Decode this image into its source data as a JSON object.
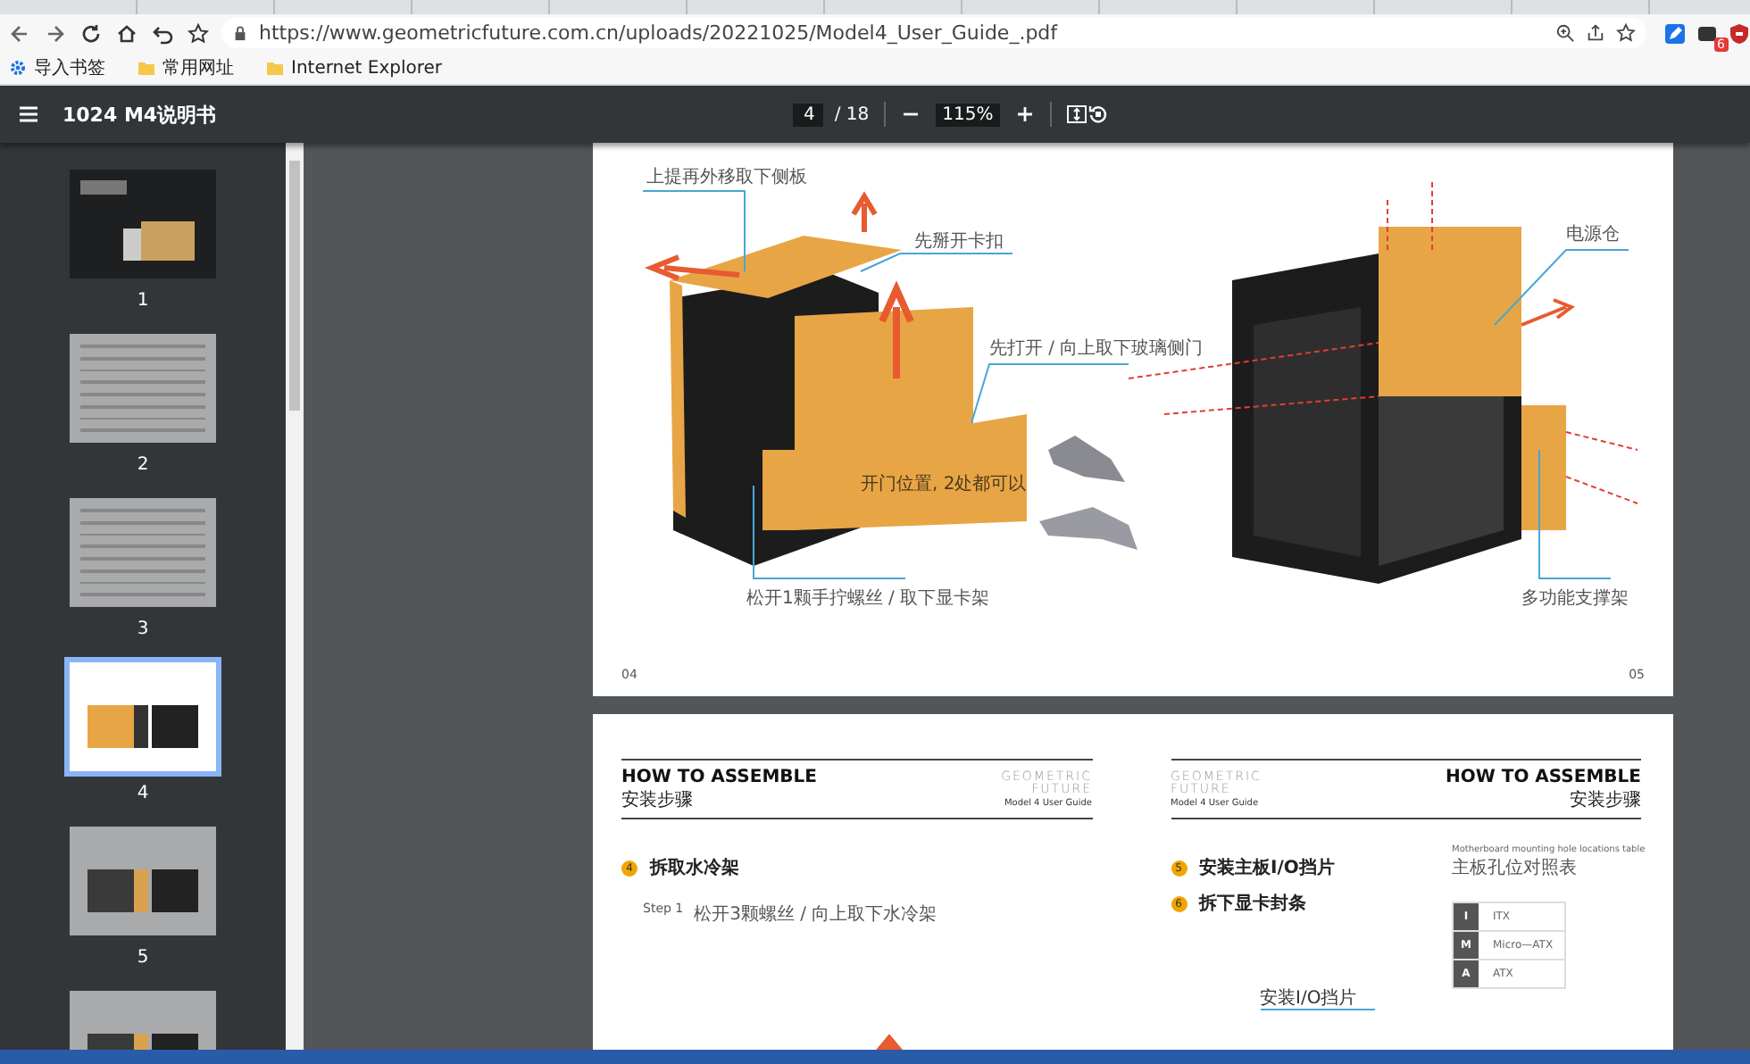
{
  "browser": {
    "url": "https://www.geometricfuture.com.cn/uploads/20221025/Model4_User_Guide_.pdf",
    "extension_badge": "6",
    "bookmarks": [
      {
        "label": "导入书签",
        "kind": "import"
      },
      {
        "label": "常用网址",
        "kind": "folder"
      },
      {
        "label": "Internet Explorer",
        "kind": "folder"
      }
    ]
  },
  "viewer": {
    "title": "1024 M4说明书",
    "page": "4",
    "page_total": "/ 18",
    "zoom": "115%"
  },
  "thumbnails": [
    {
      "number": "1",
      "kind": "cover",
      "selected": false
    },
    {
      "number": "2",
      "kind": "text",
      "selected": false
    },
    {
      "number": "3",
      "kind": "text",
      "selected": false
    },
    {
      "number": "4",
      "kind": "illustration",
      "selected": true
    },
    {
      "number": "5",
      "kind": "illustration",
      "selected": false
    },
    {
      "kind": "illustration",
      "selected": false
    }
  ],
  "spread_1": {
    "callouts": [
      {
        "text": "上提再外移取下侧板",
        "kind": "leader"
      },
      {
        "text": "先掰开卡扣",
        "kind": "leader"
      },
      {
        "text": "先打开 / 向上取下玻璃侧门",
        "kind": "leader"
      },
      {
        "text": "开门位置, 2处都可以",
        "kind": "inline"
      },
      {
        "text": "松开1颗手拧螺丝 / 取下显卡架",
        "kind": "leader"
      },
      {
        "text": "电源仓",
        "kind": "leader"
      },
      {
        "text": "多功能支撑架",
        "kind": "leader"
      }
    ],
    "page_numbers": [
      "04",
      "05"
    ]
  },
  "spread_2": {
    "headers": [
      {
        "heading": "HOW TO ASSEMBLE",
        "subheading": "安装步骤",
        "logo_top": "GEOMETRIC",
        "logo_bottom": "FUTURE",
        "logo_caption": "Model 4 User Guide"
      },
      {
        "heading": "HOW TO ASSEMBLE",
        "subheading": "安装步骤",
        "logo_top": "GEOMETRIC",
        "logo_bottom": "FUTURE",
        "logo_caption": "Model 4 User Guide"
      }
    ],
    "left_steps": [
      {
        "number": "4",
        "title": "拆取水冷架"
      }
    ],
    "left_substep": {
      "label": "Step 1",
      "text": "松开3颗螺丝 / 向上取下水冷架"
    },
    "right_steps": [
      {
        "number": "5",
        "title": "安装主板I/O挡片"
      },
      {
        "number": "6",
        "title": "拆下显卡封条"
      }
    ],
    "table_title": "Motherboard mounting hole locations table",
    "table_subtitle": "主板孔位对照表",
    "table_rows": [
      {
        "key": "I",
        "value": "ITX"
      },
      {
        "key": "M",
        "value": "Micro—ATX"
      },
      {
        "key": "A",
        "value": "ATX"
      }
    ],
    "io_label": "安装I/O挡片"
  }
}
